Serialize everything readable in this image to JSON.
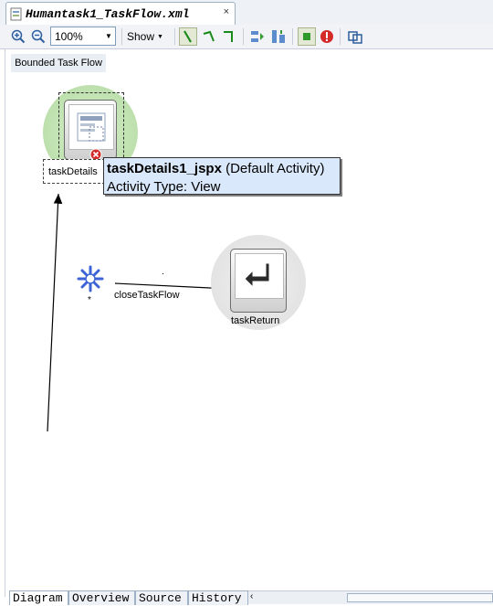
{
  "document_tab": {
    "title": "Humantask1_TaskFlow.xml",
    "close": "×",
    "icon": "xml-file-icon"
  },
  "toolbar": {
    "zoom_in_icon": "zoom-in-icon",
    "zoom_out_icon": "zoom-out-icon",
    "zoom_value": "100%",
    "show_label": "Show",
    "tools": [
      "control-flow-icon",
      "wildcard-flow-icon",
      "return-flow-icon",
      "align-icon",
      "layout-icon",
      "activity-icon",
      "error-icon",
      "refresh-icon"
    ]
  },
  "canvas": {
    "header_label": "Bounded Task Flow",
    "nodes": {
      "task_details": {
        "label": "taskDetails",
        "icon": "view-page-icon",
        "badge": "error-badge-icon"
      },
      "wildcard": {
        "label": "*",
        "icon": "wildcard-icon"
      },
      "task_return": {
        "label": "taskReturn",
        "icon": "return-arrow-icon"
      }
    },
    "edges": {
      "close_task_flow": "closeTaskFlow"
    },
    "tooltip": {
      "name": "taskDetails1_jspx",
      "suffix": "(Default Activity)",
      "line2": "Activity Type: View"
    }
  },
  "bottom_tabs": [
    "Diagram",
    "Overview",
    "Source",
    "History"
  ],
  "colors": {
    "default_activity_halo": "#bde0ad",
    "return_halo": "#e3e3e3",
    "tooltip_bg": "#d9e8fb",
    "wildcard_blue": "#3d63d6"
  }
}
